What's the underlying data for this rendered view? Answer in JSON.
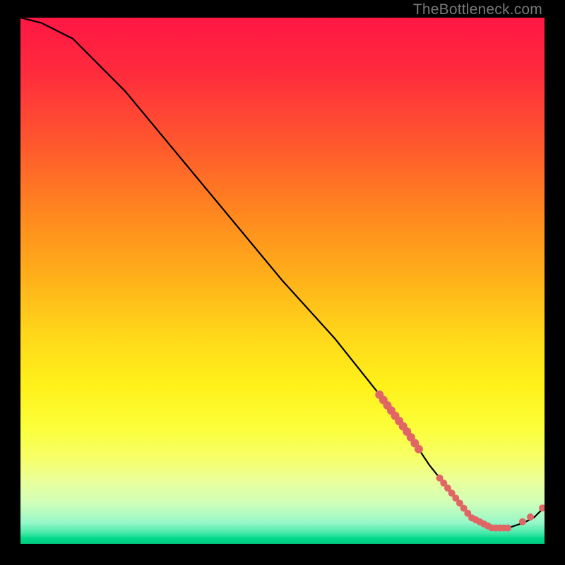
{
  "watermark": "TheBottleneck.com",
  "chart_data": {
    "type": "line",
    "title": "",
    "xlabel": "",
    "ylabel": "",
    "xlim": [
      0,
      100
    ],
    "ylim": [
      0,
      100
    ],
    "series": [
      {
        "name": "bottleneck-curve",
        "x": [
          0,
          4,
          10,
          20,
          30,
          40,
          50,
          60,
          68,
          74,
          78,
          82,
          86,
          90,
          93,
          96,
          98,
          100
        ],
        "y": [
          100,
          99,
          96,
          86,
          74,
          62,
          50,
          39,
          29,
          21,
          15,
          10,
          5,
          3,
          3,
          4,
          5,
          7
        ]
      }
    ],
    "marker_clusters": [
      {
        "name": "upper-segment",
        "xrange": [
          68.5,
          76
        ],
        "y_on_curve": true,
        "count": 11,
        "radius": 6
      },
      {
        "name": "lower-band",
        "xrange": [
          80,
          93
        ],
        "y_on_curve": true,
        "count": 18,
        "radius": 5
      },
      {
        "name": "tail",
        "points": [
          [
            95.8,
            4.2
          ],
          [
            97.3,
            5.1
          ],
          [
            99.6,
            6.8
          ]
        ],
        "radius": 5
      }
    ],
    "marker_color": "#e06666",
    "curve_color": "#000000",
    "curve_width": 2.2
  }
}
